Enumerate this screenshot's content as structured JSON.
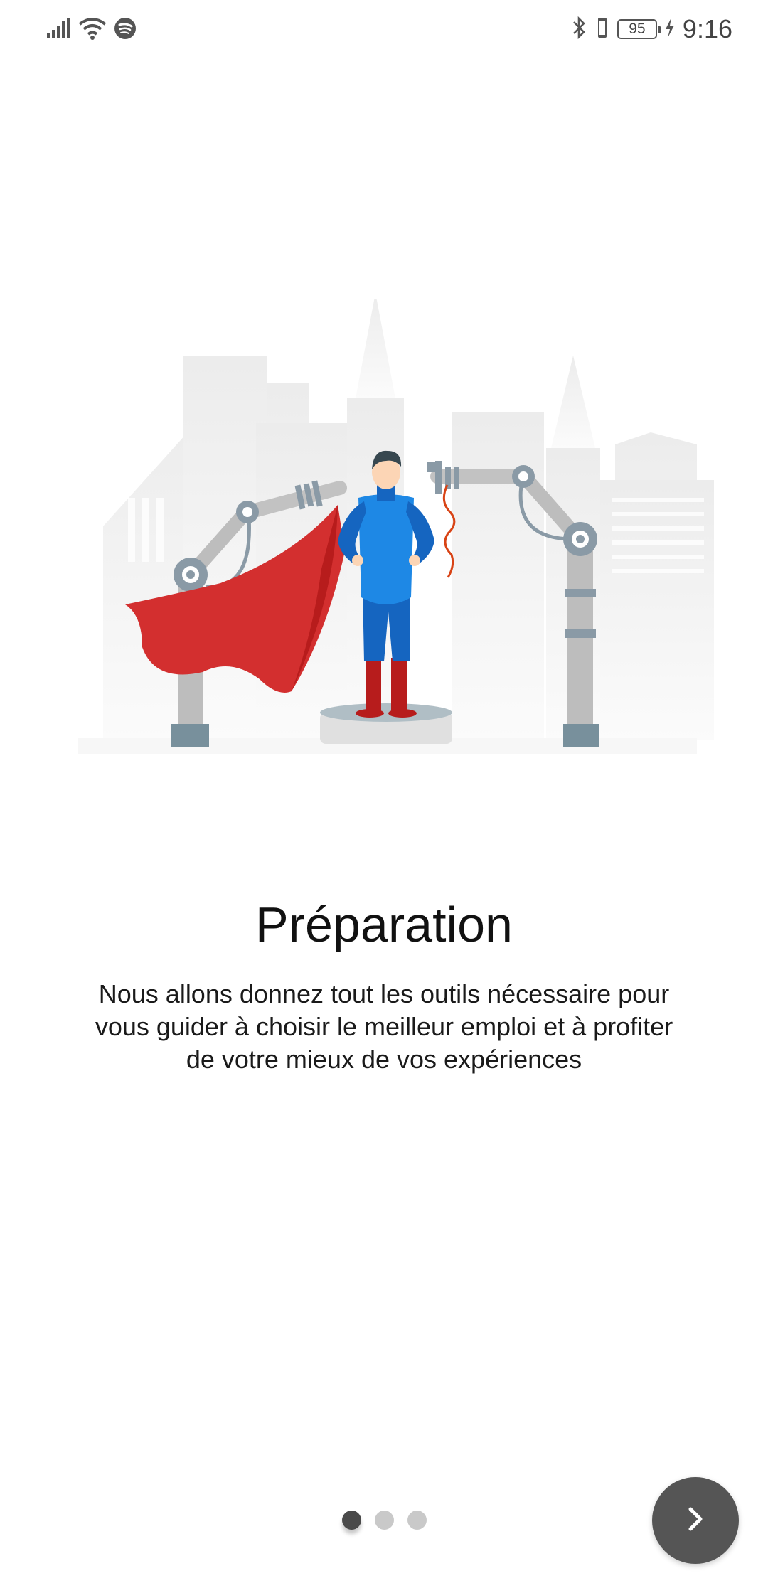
{
  "status_bar": {
    "time": "9:16",
    "battery_level": "95",
    "icons": [
      "signal-icon",
      "wifi-icon",
      "spotify-icon",
      "bluetooth-icon",
      "vibrate-icon",
      "charging-icon"
    ]
  },
  "onboarding": {
    "title": "Préparation",
    "description": "Nous allons donnez tout les outils nécessaire pour vous guider à choisir le meilleur emploi et à profiter de votre mieux de vos expériences",
    "page_count": 3,
    "active_page": 1,
    "next_icon": "chevron-right-icon"
  },
  "colors": {
    "cape": "#c62828",
    "suit": "#1e6fd1",
    "robot_arm": "#bdbdbd",
    "next_button": "#555555",
    "dot_active": "#4a4a4a",
    "dot_inactive": "#c9c9c9"
  }
}
